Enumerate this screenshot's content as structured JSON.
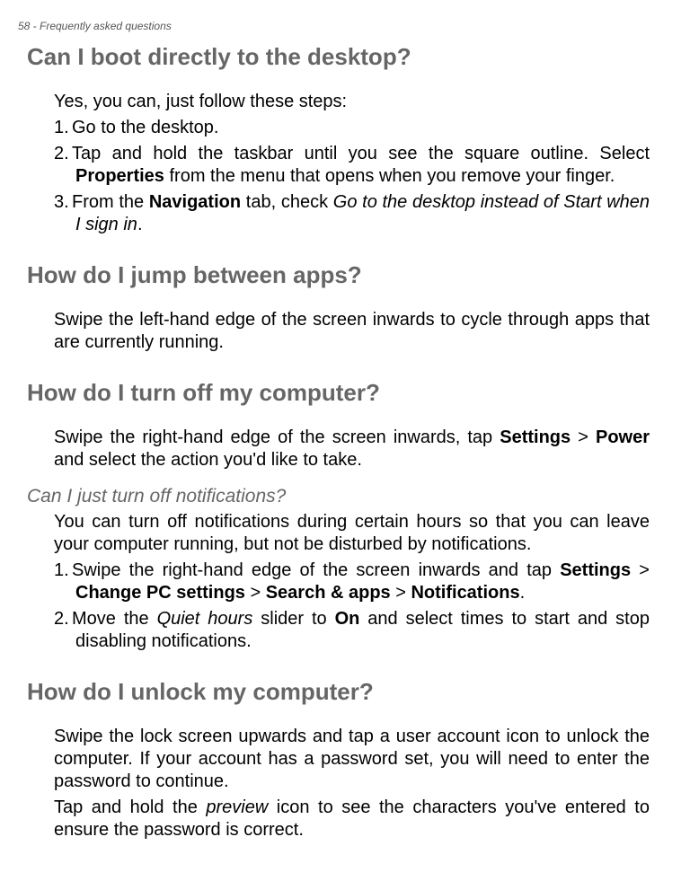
{
  "header": "58 - Frequently asked questions",
  "s1": {
    "title": "Can I boot directly to the desktop?",
    "intro": "Yes, you can, just follow these steps:",
    "l1": "Go to the desktop.",
    "l2a": "Tap and hold the taskbar until you see the square outline. Select ",
    "l2b": "Properties",
    "l2c": " from the menu that opens when you remove your finger.",
    "l3a": "From the ",
    "l3b": "Navigation",
    "l3c": " tab, check ",
    "l3d": "Go to the desktop instead of Start when I sign in",
    "l3e": "."
  },
  "s2": {
    "title": "How do I jump between apps?",
    "p1": "Swipe the left-hand edge of the screen inwards to cycle through apps that are currently running."
  },
  "s3": {
    "title": "How do I turn off my computer?",
    "p1a": "Swipe the right-hand edge of the screen inwards, tap ",
    "p1b": "Settings",
    "p1c": " > ",
    "p1d": "Power",
    "p1e": " and select the action you'd like to take."
  },
  "s4": {
    "title": "Can I just turn off notifications?",
    "p1": "You can turn off notifications during certain hours so that you can leave your computer running, but not be disturbed by notifications.",
    "l1a": "Swipe the right-hand edge of the screen inwards and tap ",
    "l1b": "Settings",
    "l1c": " > ",
    "l1d": "Change PC settings",
    "l1e": " > ",
    "l1f": "Search & apps",
    "l1g": " > ",
    "l1h": "Notifications",
    "l1i": ".",
    "l2a": "Move the ",
    "l2b": "Quiet hours",
    "l2c": " slider to ",
    "l2d": "On",
    "l2e": " and select times to start and stop disabling notifications."
  },
  "s5": {
    "title": "How do I unlock my computer?",
    "p1": "Swipe the lock screen upwards and tap a user account icon to unlock the computer. If your account has a password set, you will need to enter the password to continue.",
    "p2a": "Tap and hold the ",
    "p2b": "preview",
    "p2c": " icon to see the characters you've entered to ensure the password is correct."
  }
}
